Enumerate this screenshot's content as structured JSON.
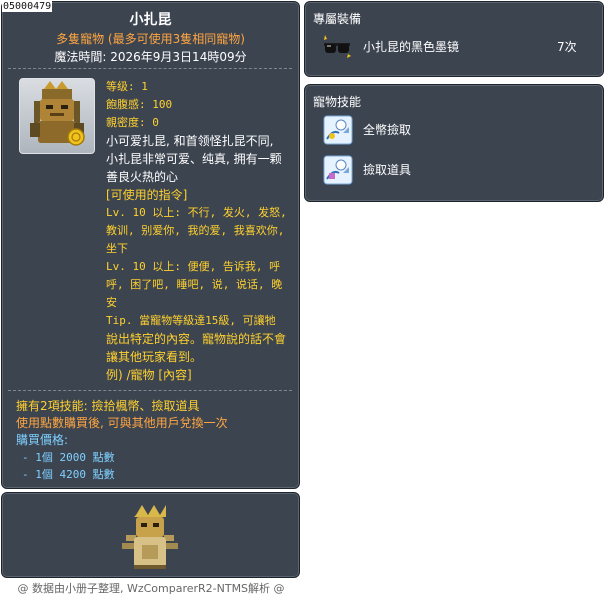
{
  "item_id": "05000479",
  "tooltip": {
    "title": "小扎昆",
    "subtitle": "多隻寵物 (最多可使用3隻相同寵物)",
    "expire": "魔法時間: 2026年9月3日14時09分",
    "stats": {
      "level": "等级: 1",
      "fullness": "飽腹感: 100",
      "closeness": "親密度: 0"
    },
    "description": [
      "小可爱扎昆, 和首领怪扎昆不同,",
      "小扎昆非常可爱、纯真, 拥有一颗",
      "善良火热的心"
    ],
    "commands_header": "[可使用的指令]",
    "commands": [
      [
        "Lv. 10 以上: 不行, 发火, 发怒,",
        "教训, 别爱你, 我的爱, 我喜欢你,",
        "坐下"
      ],
      [
        "Lv. 10 以上: 便便, 告诉我, 呼",
        "呼, 困了吧, 睡吧, 说, 说话, 晚",
        "安"
      ]
    ],
    "tip": [
      "Tip. 當寵物等級達15級, 可讓牠",
      "說出特定的內容。寵物說的話不會",
      "讓其他玩家看到。",
      "例) /寵物 [內容]"
    ],
    "skills_line": "擁有2項技能: 撿拾楓幣、撿取道具",
    "trade_line": "使用點數購買後, 可與其他用戶兌換一次",
    "price_label": "購買價格:",
    "prices": [
      "- 1個 2000 點數",
      "- 1個 4200 點數"
    ]
  },
  "footer": "@ 数据由小册子整理, WzComparerR2-NTMS解析 @",
  "exclusive": {
    "title": "專屬裝備",
    "item_name": "小扎昆的黑色墨镜",
    "item_count": "7次"
  },
  "skills": {
    "title": "寵物技能",
    "items": [
      "全幣撿取",
      "撿取道具"
    ]
  },
  "colors": {
    "panel_bg": "#3c4450",
    "accent_gold": "#ffd12e",
    "accent_orange": "#ffa640"
  }
}
